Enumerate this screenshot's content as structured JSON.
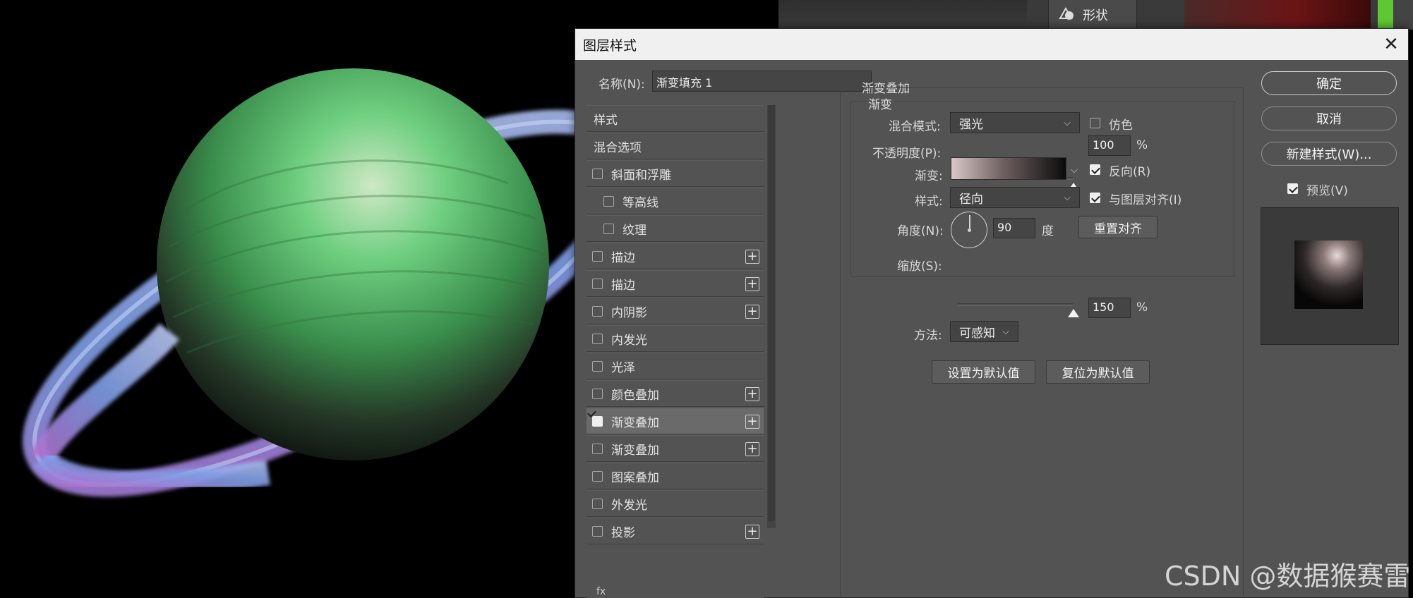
{
  "dialog": {
    "title": "图层样式",
    "close_glyph": "✕",
    "name_label": "名称(N):",
    "name_value": "渐变填充 1"
  },
  "style_list": {
    "items": [
      {
        "label": "样式",
        "checkbox": null,
        "plus": false
      },
      {
        "label": "混合选项",
        "checkbox": null,
        "plus": false
      },
      {
        "label": "斜面和浮雕",
        "checkbox": false,
        "plus": false
      },
      {
        "label": "等高线",
        "checkbox": false,
        "plus": false,
        "indent": true
      },
      {
        "label": "纹理",
        "checkbox": false,
        "plus": false,
        "indent": true
      },
      {
        "label": "描边",
        "checkbox": false,
        "plus": true
      },
      {
        "label": "描边",
        "checkbox": false,
        "plus": true
      },
      {
        "label": "内阴影",
        "checkbox": false,
        "plus": true
      },
      {
        "label": "内发光",
        "checkbox": false,
        "plus": false
      },
      {
        "label": "光泽",
        "checkbox": false,
        "plus": false
      },
      {
        "label": "颜色叠加",
        "checkbox": false,
        "plus": true
      },
      {
        "label": "渐变叠加",
        "checkbox": true,
        "plus": true,
        "selected": true
      },
      {
        "label": "渐变叠加",
        "checkbox": false,
        "plus": true
      },
      {
        "label": "图案叠加",
        "checkbox": false,
        "plus": false
      },
      {
        "label": "外发光",
        "checkbox": false,
        "plus": false
      },
      {
        "label": "投影",
        "checkbox": false,
        "plus": true
      }
    ],
    "plus_glyph": "+",
    "footer": "fx"
  },
  "panel": {
    "section_title": "渐变叠加",
    "group_title": "渐变",
    "blend_mode_label": "混合模式:",
    "blend_mode_value": "强光",
    "dither_label": "仿色",
    "dither_checked": false,
    "opacity_label": "不透明度(P):",
    "opacity_value": "100",
    "opacity_level": 1.0,
    "percent": "%",
    "gradient_label": "渐变:",
    "reverse_label": "反向(R)",
    "reverse_checked": true,
    "style_label": "样式:",
    "style_value": "径向",
    "align_label": "与图层对齐(I)",
    "align_checked": true,
    "angle_label": "角度(N):",
    "angle_value": "90",
    "degree_label": "度",
    "reset_align_button": "重置对齐",
    "scale_label": "缩放(S):",
    "scale_value": "150",
    "scale_level": 1.0,
    "method_label": "方法:",
    "method_value": "可感知",
    "set_default_button": "设置为默认值",
    "reset_default_button": "复位为默认值"
  },
  "right_buttons": {
    "ok": "确定",
    "cancel": "取消",
    "new_style": "新建样式(W)...",
    "preview_label": "预览(V)",
    "preview_checked": true
  },
  "top_strip": {
    "shape_label": "形状"
  },
  "watermark": "CSDN @数据猴赛雷",
  "colors": {
    "dialog_bg": "#535353",
    "titlebar_bg": "#f0f0f0",
    "planet_green": "#58b86a",
    "ring_blue": "#8aa6e0",
    "ring_purple": "#a060c0",
    "toolbar_green": "#5ec832"
  }
}
